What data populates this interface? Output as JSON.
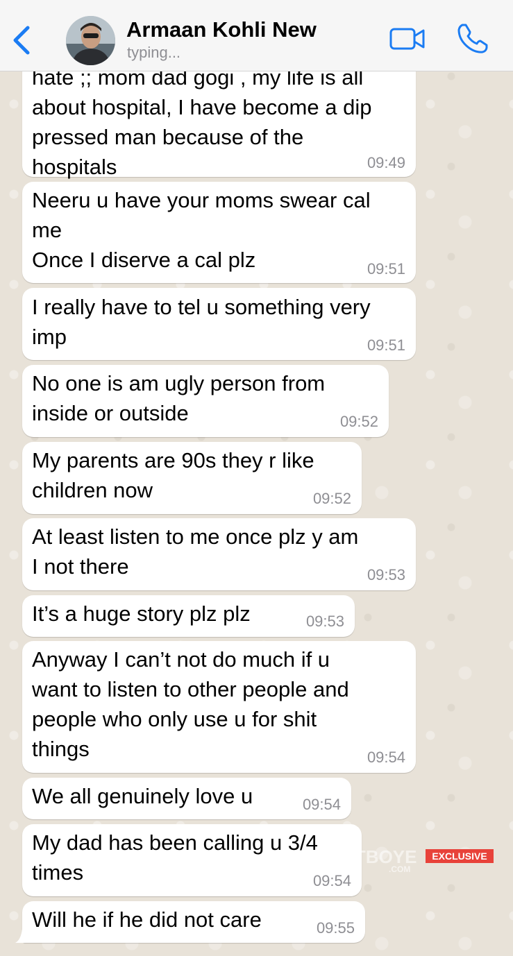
{
  "header": {
    "contact_name": "Armaan Kohli New",
    "status": "typing...",
    "back_icon": "chevron-left-icon",
    "video_icon": "video-camera-icon",
    "phone_icon": "phone-icon",
    "accent_color": "#1b7cf3"
  },
  "messages": [
    {
      "text": "hate ;; mom dad gogi , my life is all\nabout hospital, I have become a dip\npressed man because of the\nhospitals",
      "time": "09:49"
    },
    {
      "text": "Neeru u have your moms swear cal\nme\nOnce I diserve a cal plz",
      "time": "09:51"
    },
    {
      "text": "I really have to tel u something very\nimp",
      "time": "09:51"
    },
    {
      "text": "No one is am ugly person from\ninside or outside",
      "time": "09:52"
    },
    {
      "text": "My parents are 90s they r like\nchildren now",
      "time": "09:52"
    },
    {
      "text": "At least listen to me once plz y am\nI not there",
      "time": "09:53"
    },
    {
      "text": "It’s a huge story plz plz",
      "time": "09:53"
    },
    {
      "text": "Anyway I can’t not do much if u\nwant to listen to other people and\npeople who only use u for shit\nthings",
      "time": "09:54"
    },
    {
      "text": "We all genuinely love u",
      "time": "09:54"
    },
    {
      "text": "My dad has been calling u 3/4\ntimes",
      "time": "09:54"
    },
    {
      "text": "Will he if he did not care",
      "time": "09:55"
    }
  ],
  "watermark": {
    "brand": "SPOTBOYE",
    "brand_sub": ".COM",
    "badge": "EXCLUSIVE"
  }
}
